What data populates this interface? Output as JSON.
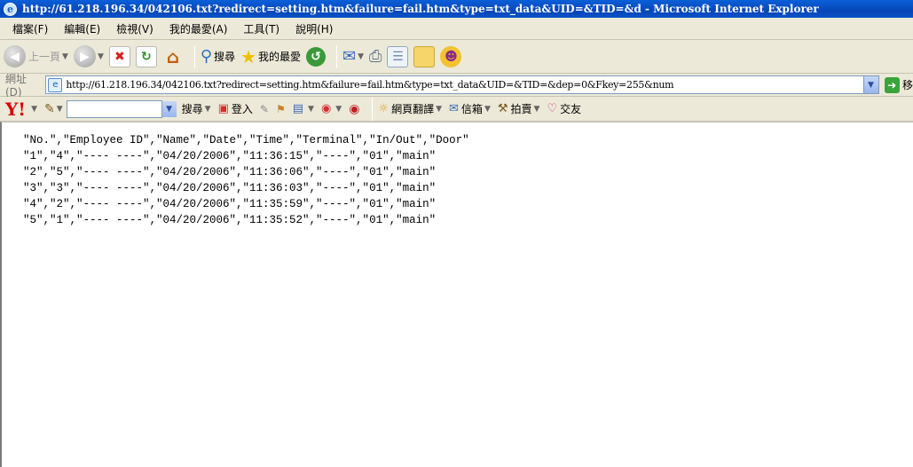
{
  "window": {
    "title": "http://61.218.196.34/042106.txt?redirect=setting.htm&failure=fail.htm&type=txt_data&UID=&TID=&d - Microsoft Internet Explorer"
  },
  "menu": {
    "items": [
      "檔案(F)",
      "編輯(E)",
      "檢視(V)",
      "我的最愛(A)",
      "工具(T)",
      "說明(H)"
    ]
  },
  "toolbar": {
    "back_label": "上一頁",
    "search_label": "搜尋",
    "favorites_label": "我的最愛"
  },
  "address": {
    "label": "網址(D)",
    "url": "http://61.218.196.34/042106.txt?redirect=setting.htm&failure=fail.htm&type=txt_data&UID=&TID=&dep=0&Fkey=255&num",
    "go_label": "移"
  },
  "yahoo": {
    "logo": "Y!",
    "search_label": "搜尋",
    "login_label": "登入",
    "translate_label": "網頁翻譯",
    "mail_label": "信箱",
    "auction_label": "拍賣",
    "social_label": "交友"
  },
  "content": {
    "lines": [
      "\"No.\",\"Employee ID\",\"Name\",\"Date\",\"Time\",\"Terminal\",\"In/Out\",\"Door\"",
      "\"1\",\"4\",\"---- ----\",\"04/20/2006\",\"11:36:15\",\"----\",\"01\",\"main\"",
      "\"2\",\"5\",\"---- ----\",\"04/20/2006\",\"11:36:06\",\"----\",\"01\",\"main\"",
      "\"3\",\"3\",\"---- ----\",\"04/20/2006\",\"11:36:03\",\"----\",\"01\",\"main\"",
      "\"4\",\"2\",\"---- ----\",\"04/20/2006\",\"11:35:59\",\"----\",\"01\",\"main\"",
      "\"5\",\"1\",\"---- ----\",\"04/20/2006\",\"11:35:52\",\"----\",\"01\",\"main\""
    ]
  },
  "colors": {
    "titlebar": "#0a5fd8",
    "chrome": "#ece9d8",
    "yahoo_red": "#d70000"
  }
}
